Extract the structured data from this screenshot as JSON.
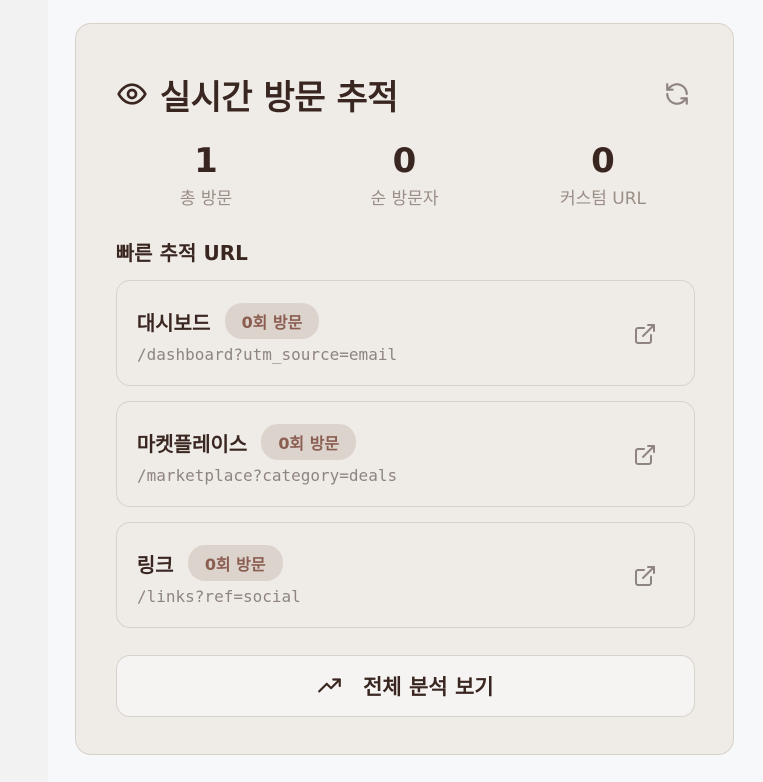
{
  "header": {
    "title": "실시간 방문 추적",
    "title_icon": "eye-icon",
    "refresh_icon": "refresh-icon"
  },
  "stats": [
    {
      "value": "1",
      "label": "총 방문"
    },
    {
      "value": "0",
      "label": "순 방문자"
    },
    {
      "value": "0",
      "label": "커스텀 URL"
    }
  ],
  "quick_links": {
    "title": "빠른 추적 URL",
    "items": [
      {
        "name": "대시보드",
        "badge": "0회 방문",
        "path": "/dashboard?utm_source=email",
        "icon": "external-link-icon"
      },
      {
        "name": "마켓플레이스",
        "badge": "0회 방문",
        "path": "/marketplace?category=deals",
        "icon": "external-link-icon"
      },
      {
        "name": "링크",
        "badge": "0회 방문",
        "path": "/links?ref=social",
        "icon": "external-link-icon"
      }
    ]
  },
  "analyze_button": {
    "label": "전체 분석 보기",
    "icon": "trending-up-icon"
  },
  "colors": {
    "card_bg": "#efebe6",
    "border": "#d8d2cc",
    "text_primary": "#3a2620",
    "text_muted": "#9b8e87",
    "badge_bg": "#dcd3cd",
    "badge_text": "#8a5d50"
  }
}
